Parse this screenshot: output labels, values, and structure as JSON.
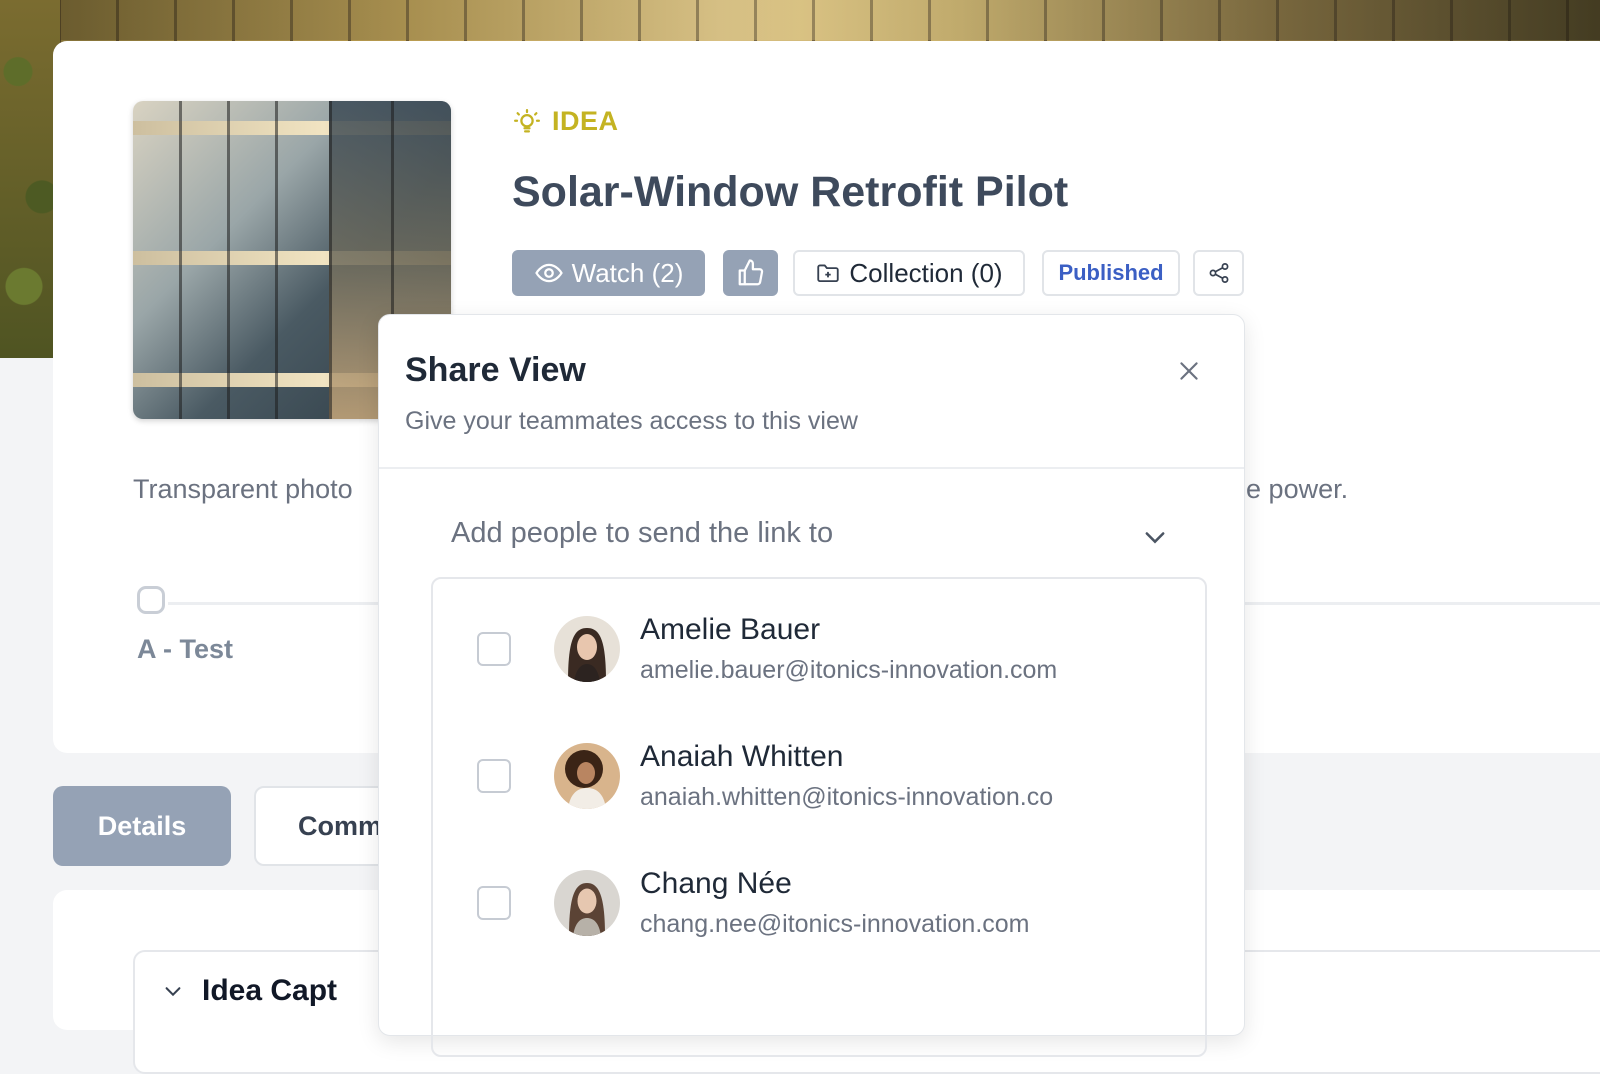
{
  "idea": {
    "type_label": "IDEA",
    "title": "Solar-Window Retrofit Pilot",
    "description_left": "Transparent photo",
    "description_right": "able power."
  },
  "actions": {
    "watch_label": "Watch (2)",
    "collection_label": "Collection (0)",
    "status_label": "Published"
  },
  "timeline": {
    "stage_label": "A - Test"
  },
  "tabs": [
    {
      "label": "Details"
    },
    {
      "label": "Comm"
    }
  ],
  "section": {
    "title": "Idea Capt"
  },
  "share": {
    "title": "Share View",
    "subtitle": "Give your teammates access to this view",
    "add_people_placeholder": "Add people to send the link to",
    "people": [
      {
        "name": "Amelie Bauer",
        "email": "amelie.bauer@itonics-innovation.com"
      },
      {
        "name": "Anaiah Whitten",
        "email": "anaiah.whitten@itonics-innovation.co"
      },
      {
        "name": "Chang Née",
        "email": "chang.nee@itonics-innovation.com"
      }
    ]
  },
  "colors": {
    "accent": "#95a2b5",
    "idea": "#c4b322",
    "published": "#3b5fc4",
    "title": "#3e4a5c"
  },
  "icons": {
    "idea": "lightbulb-icon",
    "watch": "eye-icon",
    "like": "thumbs-up-icon",
    "collection": "folder-plus-icon",
    "share": "share-icon",
    "close": "close-icon",
    "dropdown": "chevron-down-icon",
    "section_toggle": "chevron-down-icon"
  }
}
